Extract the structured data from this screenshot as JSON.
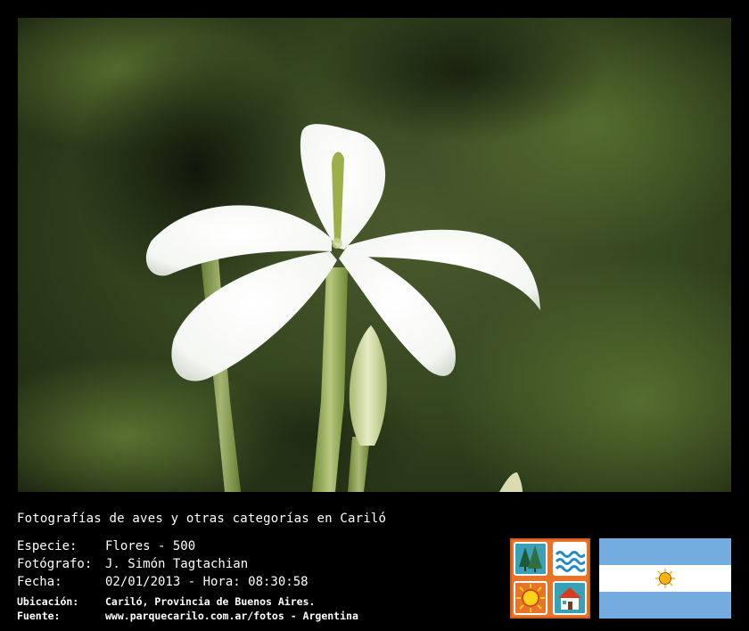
{
  "caption": {
    "title": "Fotografías de aves y otras categorías en Cariló"
  },
  "fields": [
    {
      "label": "Especie:",
      "value": "Flores - 500"
    },
    {
      "label": "Fotógrafo:",
      "value": "J. Simón Tagtachian"
    },
    {
      "label": "Fecha:",
      "value": "02/01/2013 - Hora: 08:30:58"
    },
    {
      "label": "Ubicación:",
      "value": "Cariló, Provincia de Buenos Aires."
    },
    {
      "label": "Fuente:",
      "value": "www.parquecarilo.com.ar/fotos - Argentina"
    }
  ],
  "colors": {
    "background": "#000000",
    "text": "#ffffff",
    "logo_orange": "#e8742a",
    "flag_blue": "#74acdf",
    "flag_sun": "#f6b40e"
  },
  "icons": [
    "trees-icon",
    "waves-icon",
    "sun-icon",
    "house-icon",
    "flag-argentina-icon"
  ]
}
